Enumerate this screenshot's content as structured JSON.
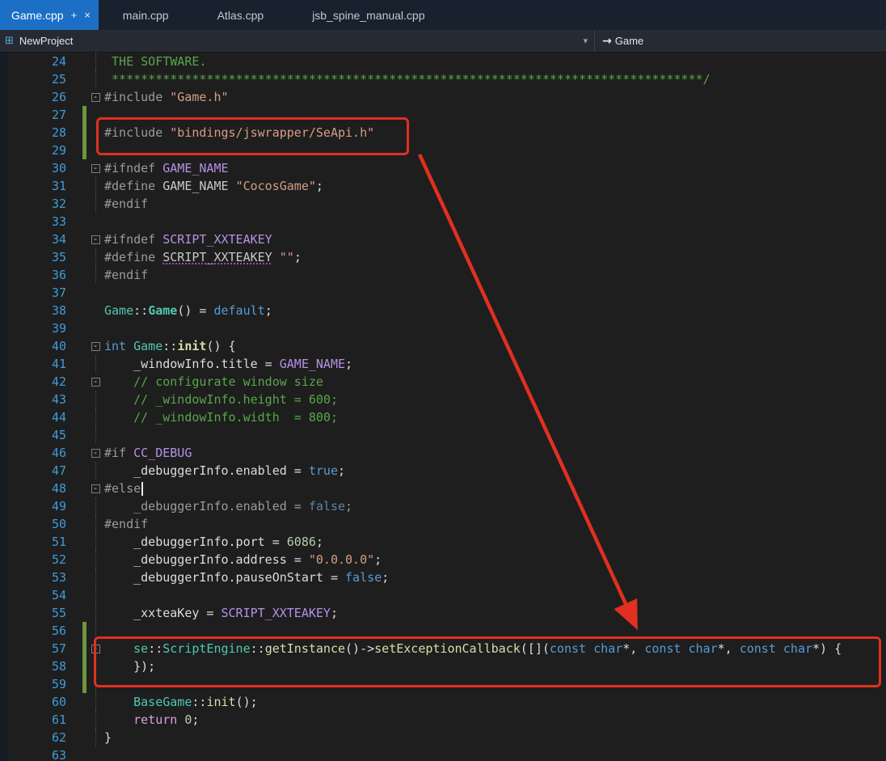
{
  "tabs": {
    "active": {
      "label": "Game.cpp",
      "pin_icon": "+",
      "close_icon": "×"
    },
    "items": [
      "main.cpp",
      "Atlas.cpp",
      "jsb_spine_manual.cpp"
    ]
  },
  "navbar": {
    "project_icon": "⊞",
    "project": "NewProject",
    "dropdown_icon": "▾",
    "member_arrow_icon": "→",
    "member": "Game"
  },
  "colors": {
    "active_tab": "#1B6FC5",
    "annotation_red": "#E0301F",
    "change_bar_green": "#6E9440",
    "editor_background": "#1E1E1E"
  },
  "editor": {
    "icons": {
      "fold_box": "-"
    },
    "lines": [
      {
        "n": 24,
        "f": "g",
        "seg": [
          [
            "cmt",
            " THE SOFTWARE."
          ]
        ]
      },
      {
        "n": 25,
        "f": "g",
        "seg": [
          [
            "cmt",
            " *********************************************************************************/"
          ]
        ]
      },
      {
        "n": 26,
        "f": "b",
        "seg": [
          [
            "pre",
            "#include "
          ],
          [
            "str",
            "\"Game.h\""
          ]
        ]
      },
      {
        "n": 27,
        "chg": true,
        "seg": []
      },
      {
        "n": 28,
        "chg": true,
        "seg": [
          [
            "pre",
            "#include "
          ],
          [
            "str",
            "\"bindings/jswrapper/SeApi.h\""
          ]
        ]
      },
      {
        "n": 29,
        "chg": true,
        "seg": []
      },
      {
        "n": 30,
        "f": "b",
        "seg": [
          [
            "pre",
            "#ifndef "
          ],
          [
            "mac",
            "GAME_NAME"
          ]
        ]
      },
      {
        "n": 31,
        "f": "g",
        "seg": [
          [
            "pre",
            "#define "
          ],
          [
            "def",
            "GAME_NAME"
          ],
          [
            "pln",
            " "
          ],
          [
            "str",
            "\"CocosGame\""
          ],
          [
            "pln",
            ";"
          ]
        ]
      },
      {
        "n": 32,
        "f": "g",
        "seg": [
          [
            "pre",
            "#endif"
          ]
        ]
      },
      {
        "n": 33,
        "seg": []
      },
      {
        "n": 34,
        "f": "b",
        "seg": [
          [
            "pre",
            "#ifndef "
          ],
          [
            "mac",
            "SCRIPT_XXTEAKEY"
          ]
        ]
      },
      {
        "n": 35,
        "f": "g",
        "seg": [
          [
            "pre",
            "#define "
          ],
          [
            "sqg",
            "SCRIPT_XXTEAKEY"
          ],
          [
            "pln",
            " "
          ],
          [
            "str",
            "\"\""
          ],
          [
            "pln",
            ";"
          ]
        ]
      },
      {
        "n": 36,
        "f": "g",
        "seg": [
          [
            "pre",
            "#endif"
          ]
        ]
      },
      {
        "n": 37,
        "seg": []
      },
      {
        "n": 38,
        "seg": [
          [
            "typ",
            "Game"
          ],
          [
            "pln",
            "::"
          ],
          [
            "typb",
            "Game"
          ],
          [
            "pln",
            "() = "
          ],
          [
            "kw",
            "default"
          ],
          [
            "pln",
            ";"
          ]
        ]
      },
      {
        "n": 39,
        "seg": []
      },
      {
        "n": 40,
        "f": "b",
        "seg": [
          [
            "kw",
            "int "
          ],
          [
            "typ",
            "Game"
          ],
          [
            "pln",
            "::"
          ],
          [
            "fnb",
            "init"
          ],
          [
            "pln",
            "() {"
          ]
        ]
      },
      {
        "n": 41,
        "f": "g",
        "seg": [
          [
            "pln",
            "    _windowInfo.title = "
          ],
          [
            "mac",
            "GAME_NAME"
          ],
          [
            "pln",
            ";"
          ]
        ]
      },
      {
        "n": 42,
        "f": "b",
        "seg": [
          [
            "cmt",
            "    // configurate window size"
          ]
        ]
      },
      {
        "n": 43,
        "f": "g",
        "seg": [
          [
            "cmt",
            "    // _windowInfo.height = 600;"
          ]
        ]
      },
      {
        "n": 44,
        "f": "g",
        "seg": [
          [
            "cmt",
            "    // _windowInfo.width  = 800;"
          ]
        ]
      },
      {
        "n": 45,
        "f": "g",
        "seg": []
      },
      {
        "n": 46,
        "f": "b",
        "seg": [
          [
            "pre",
            "#if "
          ],
          [
            "mac",
            "CC_DEBUG"
          ]
        ]
      },
      {
        "n": 47,
        "f": "g",
        "seg": [
          [
            "pln",
            "    _debuggerInfo.enabled = "
          ],
          [
            "kw",
            "true"
          ],
          [
            "pln",
            ";"
          ]
        ]
      },
      {
        "n": 48,
        "f": "b",
        "caret": true,
        "seg": [
          [
            "pre",
            "#else"
          ]
        ]
      },
      {
        "n": 49,
        "f": "g",
        "seg": [
          [
            "inact",
            "    _debuggerInfo.enabled = "
          ],
          [
            "kwd",
            "false"
          ],
          [
            "inact",
            ";"
          ]
        ]
      },
      {
        "n": 50,
        "f": "g",
        "seg": [
          [
            "pre",
            "#endif"
          ]
        ]
      },
      {
        "n": 51,
        "f": "g",
        "seg": [
          [
            "pln",
            "    _debuggerInfo.port = "
          ],
          [
            "num",
            "6086"
          ],
          [
            "pln",
            ";"
          ]
        ]
      },
      {
        "n": 52,
        "f": "g",
        "seg": [
          [
            "pln",
            "    _debuggerInfo.address = "
          ],
          [
            "str",
            "\"0.0.0.0\""
          ],
          [
            "pln",
            ";"
          ]
        ]
      },
      {
        "n": 53,
        "f": "g",
        "seg": [
          [
            "pln",
            "    _debuggerInfo.pauseOnStart = "
          ],
          [
            "kw",
            "false"
          ],
          [
            "pln",
            ";"
          ]
        ]
      },
      {
        "n": 54,
        "f": "g",
        "seg": []
      },
      {
        "n": 55,
        "f": "g",
        "seg": [
          [
            "pln",
            "    _xxteaKey = "
          ],
          [
            "mac",
            "SCRIPT_XXTEAKEY"
          ],
          [
            "pln",
            ";"
          ]
        ]
      },
      {
        "n": 56,
        "f": "g",
        "chg": true,
        "seg": []
      },
      {
        "n": 57,
        "f": "b",
        "chg": true,
        "seg": [
          [
            "pln",
            "    "
          ],
          [
            "typ",
            "se"
          ],
          [
            "pln",
            "::"
          ],
          [
            "typ",
            "ScriptEngine"
          ],
          [
            "pln",
            "::"
          ],
          [
            "fn",
            "getInstance"
          ],
          [
            "pln",
            "()->"
          ],
          [
            "fn",
            "setExceptionCallback"
          ],
          [
            "pln",
            "([]("
          ],
          [
            "kw",
            "const"
          ],
          [
            "pln",
            " "
          ],
          [
            "kw",
            "char"
          ],
          [
            "pln",
            "*, "
          ],
          [
            "kw",
            "const"
          ],
          [
            "pln",
            " "
          ],
          [
            "kw",
            "char"
          ],
          [
            "pln",
            "*, "
          ],
          [
            "kw",
            "const"
          ],
          [
            "pln",
            " "
          ],
          [
            "kw",
            "char"
          ],
          [
            "pln",
            "*) {"
          ]
        ]
      },
      {
        "n": 58,
        "f": "g",
        "chg": true,
        "seg": [
          [
            "pln",
            "    });"
          ]
        ]
      },
      {
        "n": 59,
        "f": "g",
        "chg": true,
        "seg": []
      },
      {
        "n": 60,
        "f": "g",
        "seg": [
          [
            "pln",
            "    "
          ],
          [
            "typ",
            "BaseGame"
          ],
          [
            "pln",
            "::"
          ],
          [
            "fn",
            "init"
          ],
          [
            "pln",
            "();"
          ]
        ]
      },
      {
        "n": 61,
        "f": "g",
        "seg": [
          [
            "pln",
            "    "
          ],
          [
            "ctl",
            "return "
          ],
          [
            "num",
            "0"
          ],
          [
            "pln",
            ";"
          ]
        ]
      },
      {
        "n": 62,
        "f": "g",
        "seg": [
          [
            "pln",
            "}"
          ]
        ]
      },
      {
        "n": 63,
        "seg": []
      }
    ]
  }
}
